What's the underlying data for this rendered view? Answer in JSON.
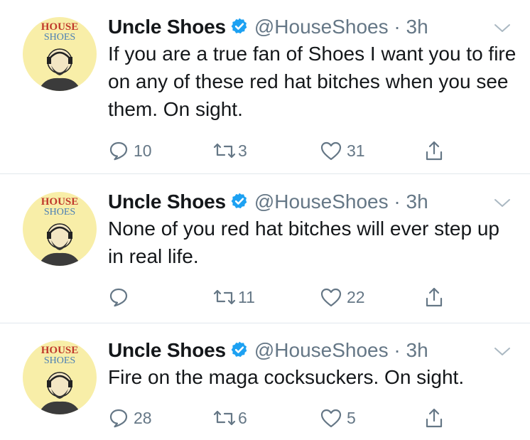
{
  "colors": {
    "text": "#14171a",
    "secondary": "#657786",
    "verified": "#1da1f2",
    "divider": "#e1e8ed",
    "avatar_bg": "#f8eea8"
  },
  "icons": {
    "reply": "speech-bubble-icon",
    "retweet": "retweet-arrows-icon",
    "like": "heart-icon",
    "share": "share-upload-icon",
    "verified": "verified-badge-icon",
    "menu": "chevron-down-icon"
  },
  "tweets": [
    {
      "avatar_text": [
        "HOUSE",
        "SHOES"
      ],
      "name": "Uncle Shoes",
      "handle": "@HouseShoes",
      "separator": "·",
      "time": "3h",
      "text": "If you are a true fan of Shoes I want you to fire on any of these red hat bitches when you see them. On sight.",
      "replies": "10",
      "retweets": "3",
      "likes": "31"
    },
    {
      "avatar_text": [
        "HOUSE",
        "SHOES"
      ],
      "name": "Uncle Shoes",
      "handle": "@HouseShoes",
      "separator": "·",
      "time": "3h",
      "text": "None of you red hat bitches will ever step up in real life.",
      "replies": "",
      "retweets": "11",
      "likes": "22"
    },
    {
      "avatar_text": [
        "HOUSE",
        "SHOES"
      ],
      "name": "Uncle Shoes",
      "handle": "@HouseShoes",
      "separator": "·",
      "time": "3h",
      "text": "Fire on the maga cocksuckers. On sight.",
      "replies": "28",
      "retweets": "6",
      "likes": "5"
    }
  ]
}
